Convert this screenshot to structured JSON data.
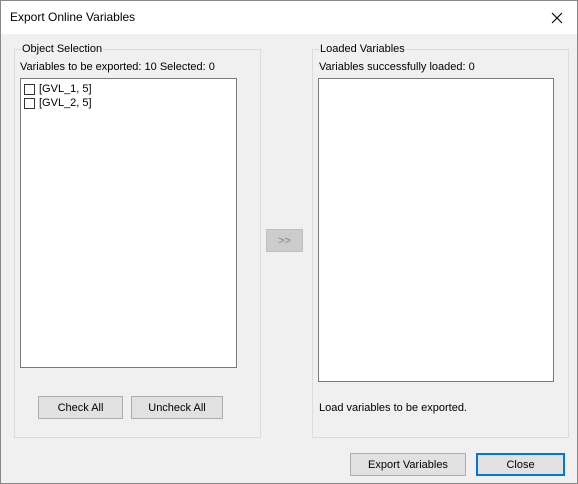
{
  "window": {
    "title": "Export Online Variables",
    "close_glyph": "×"
  },
  "object_selection": {
    "label": "Object Selection",
    "info": "Variables to be exported: 10 Selected: 0",
    "items": [
      {
        "label": "[GVL_1, 5]",
        "checked": false
      },
      {
        "label": "[GVL_2, 5]",
        "checked": false
      }
    ],
    "check_all_label": "Check All",
    "uncheck_all_label": "Uncheck All"
  },
  "transfer": {
    "label": ">>"
  },
  "loaded_variables": {
    "label": "Loaded Variables",
    "info": "Variables successfully loaded: 0",
    "status": "Load variables to be exported."
  },
  "footer": {
    "export_label": "Export Variables",
    "close_label": "Close"
  },
  "colors": {
    "default_button_border": "#0078d7",
    "window_bg": "#f0f0f0"
  }
}
